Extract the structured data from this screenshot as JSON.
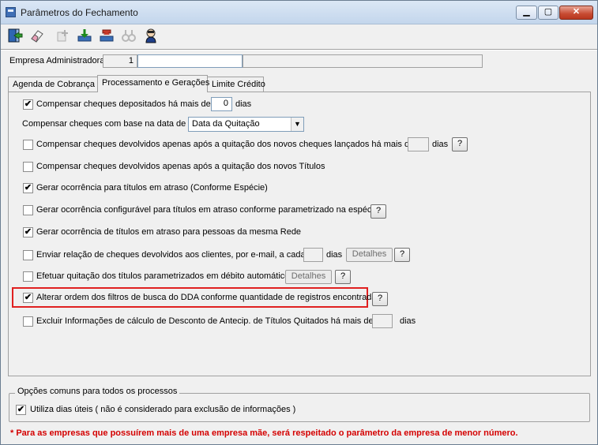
{
  "window": {
    "title": "Parâmetros do Fechamento",
    "minimize": "▁",
    "maximize": "▢",
    "close": "✕"
  },
  "toolbar": {
    "icons": [
      "exit-icon",
      "eraser-icon",
      "plus-disabled-icon",
      "import-icon",
      "export-icon",
      "binoculars-disabled-icon",
      "help-agent-icon"
    ]
  },
  "header": {
    "empresa_label": "Empresa Administradora",
    "empresa_code": "1",
    "empresa_name": "",
    "extra": ""
  },
  "tabs": [
    "Agenda de Cobrança",
    "Processamento e Gerações",
    "Limite Crédito"
  ],
  "options": {
    "o1": {
      "label": "Compensar cheques depositados há mais de",
      "checked": "✔",
      "value": "0",
      "suffix": "dias"
    },
    "o2": {
      "label": "Compensar cheques com base na data de",
      "select": "Data da Quitação"
    },
    "o3": {
      "label": "Compensar cheques devolvidos apenas após a quitação dos novos cheques lançados há mais de",
      "value": "",
      "suffix": "dias",
      "help": "?"
    },
    "o4": {
      "label": "Compensar cheques devolvidos apenas após a quitação dos novos Títulos"
    },
    "o5": {
      "label": "Gerar ocorrência para títulos em atraso (Conforme Espécie)",
      "checked": "✔"
    },
    "o6": {
      "label": "Gerar ocorrência configurável para títulos em atraso conforme parametrizado na espécie",
      "help": "?"
    },
    "o7": {
      "label": "Gerar ocorrência de títulos em atraso para pessoas da mesma Rede",
      "checked": "✔"
    },
    "o8": {
      "label": "Enviar relação de cheques devolvidos aos clientes, por e-mail, a cada",
      "value": "",
      "suffix": "dias",
      "details": "Detalhes",
      "help": "?"
    },
    "o9": {
      "label": "Efetuar quitação dos títulos parametrizados em débito automático",
      "details": "Detalhes",
      "help": "?"
    },
    "o10": {
      "label": "Alterar ordem dos filtros de busca do DDA conforme quantidade de registros encontrada",
      "checked": "✔",
      "help": "?"
    },
    "o11": {
      "label": "Excluir Informações de cálculo de Desconto de Antecip. de Títulos Quitados há mais de",
      "value": "",
      "suffix": "dias"
    }
  },
  "common": {
    "title": "Opções comuns para todos os processos",
    "util_label": "Utiliza dias úteis ( não é considerado para exclusão de informações )",
    "util_checked": "✔"
  },
  "footnote": "* Para as empresas que possuírem mais de uma empresa mãe, será respeitado o parâmetro da empresa de menor número.",
  "colors": {
    "highlight": "#e02020",
    "footnote": "#d40000"
  }
}
